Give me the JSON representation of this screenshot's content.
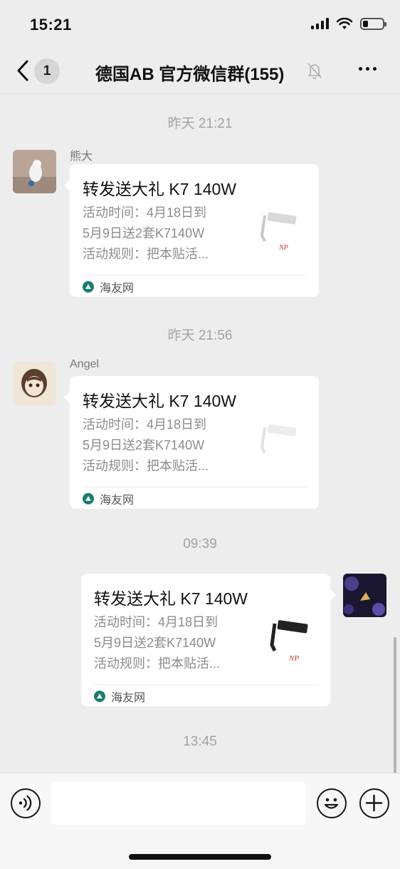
{
  "status_bar": {
    "time": "15:21",
    "battery_level": 0.25,
    "icons": [
      "signal-icon",
      "wifi-icon",
      "battery-icon"
    ]
  },
  "nav": {
    "unread_count": "1",
    "title": "德国AB 官方微信群(155)",
    "icons": [
      "back-chevron-icon",
      "mute-bell-icon",
      "more-dots-icon"
    ]
  },
  "messages": [
    {
      "timestamp": "昨天 21:21",
      "sender": "熊大",
      "side": "left",
      "card": {
        "title": "转发送大礼 K7 140W",
        "desc_lines": [
          "活动时间：4月18日到",
          "5月9日送2套K7140W",
          "活动规则：把本贴活..."
        ],
        "source": "海友网"
      }
    },
    {
      "timestamp": "昨天 21:56",
      "sender": "Angel",
      "side": "left",
      "card": {
        "title": "转发送大礼 K7 140W",
        "desc_lines": [
          "活动时间：4月18日到",
          "5月9日送2套K7140W",
          "活动规则：把本贴活..."
        ],
        "source": "海友网"
      }
    },
    {
      "timestamp": "09:39",
      "sender": "",
      "side": "right",
      "card": {
        "title": "转发送大礼 K7 140W",
        "desc_lines": [
          "活动时间：4月18日到",
          "5月9日送2套K7140W",
          "活动规则：把本贴活..."
        ],
        "source": "海友网"
      }
    }
  ],
  "last_timestamp": "13:45",
  "colors": {
    "background": "#ededed",
    "bubble": "#ffffff",
    "source_icon": "#1e7a6f",
    "timestamp_text": "#a3a3a3"
  }
}
